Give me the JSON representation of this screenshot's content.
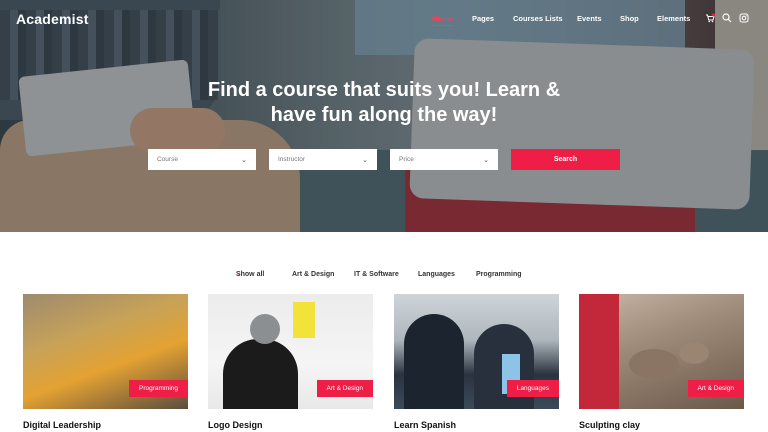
{
  "brand": {
    "logo": "Academist",
    "accent": "#ee1e46"
  },
  "nav": {
    "items": [
      {
        "label": "Home",
        "active": true
      },
      {
        "label": "Pages",
        "active": false
      },
      {
        "label": "Courses Lists",
        "active": false
      },
      {
        "label": "Events",
        "active": false
      },
      {
        "label": "Shop",
        "active": false
      },
      {
        "label": "Elements",
        "active": false
      }
    ],
    "icons": [
      "cart-icon",
      "search-icon",
      "instagram-icon"
    ]
  },
  "hero": {
    "title_line1": "Find a course that suits you! Learn &",
    "title_line2": "have fun along the way!"
  },
  "search": {
    "course_placeholder": "Course",
    "instructor_placeholder": "Instructor",
    "price_placeholder": "Price",
    "button_label": "Search"
  },
  "filters": [
    "Show all",
    "Art & Design",
    "IT & Software",
    "Languages",
    "Programming"
  ],
  "courses": [
    {
      "title": "Digital Leadership",
      "category": "Programming"
    },
    {
      "title": "Logo Design",
      "category": "Art & Design"
    },
    {
      "title": "Learn Spanish",
      "category": "Languages"
    },
    {
      "title": "Sculpting clay",
      "category": "Art & Design"
    }
  ]
}
